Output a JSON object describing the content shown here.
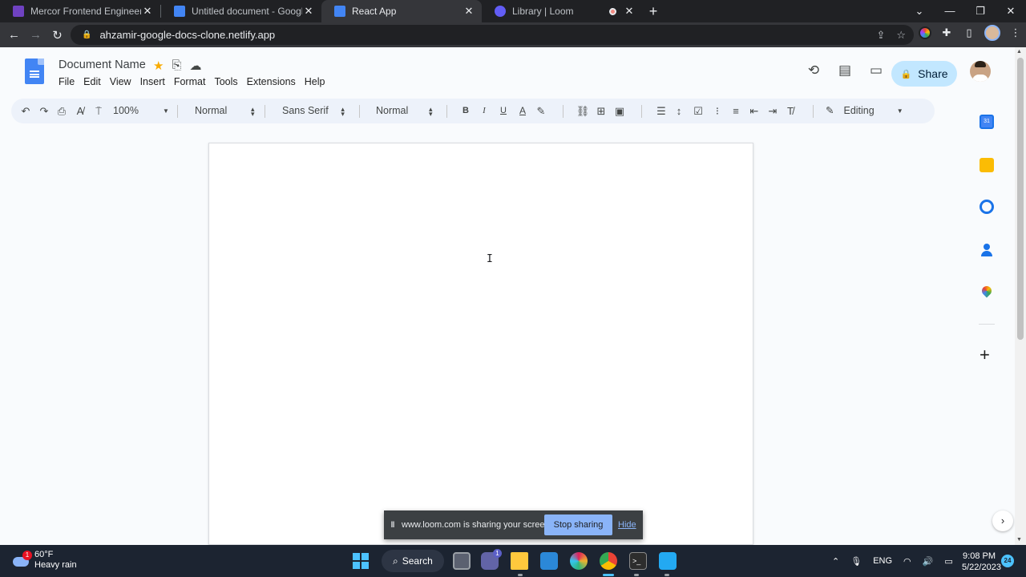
{
  "browser": {
    "tabs": [
      {
        "title": "Mercor Frontend Engineer Vetting",
        "favicon_color": "#6f42c1",
        "active": false
      },
      {
        "title": "Untitled document - Google Docs",
        "favicon_color": "#4285f4",
        "active": false
      },
      {
        "title": "React App",
        "favicon_color": "#4285f4",
        "active": true
      },
      {
        "title": "Library | Loom",
        "favicon_color": "#625df5",
        "active": false
      }
    ],
    "new_tab_label": "+",
    "url": "ahzamir-google-docs-clone.netlify.app"
  },
  "docs": {
    "document_name": "Document Name",
    "menu": [
      "File",
      "Edit",
      "View",
      "Insert",
      "Format",
      "Tools",
      "Extensions",
      "Help"
    ],
    "share_label": "Share",
    "toolbar": {
      "zoom": "100%",
      "style": "Normal",
      "font": "Sans Serif",
      "size": "Normal",
      "bold": "B",
      "italic": "I",
      "underline": "U",
      "text_color": "A",
      "mode": "Editing"
    }
  },
  "loom": {
    "message": "www.loom.com is sharing your screen.",
    "stop_label": "Stop sharing",
    "hide_label": "Hide"
  },
  "taskbar": {
    "weather_temp": "60°F",
    "weather_desc": "Heavy rain",
    "weather_badge": "1",
    "search_label": "Search",
    "teams_badge": "1",
    "language": "ENG",
    "time": "9:08 PM",
    "date": "5/22/2023",
    "notification_count": "24"
  },
  "colors": {
    "accent": "#1a73e8",
    "share_bg": "#c2e7ff",
    "toolbar_bg": "#edf2fa",
    "chrome_dark": "#202124"
  }
}
